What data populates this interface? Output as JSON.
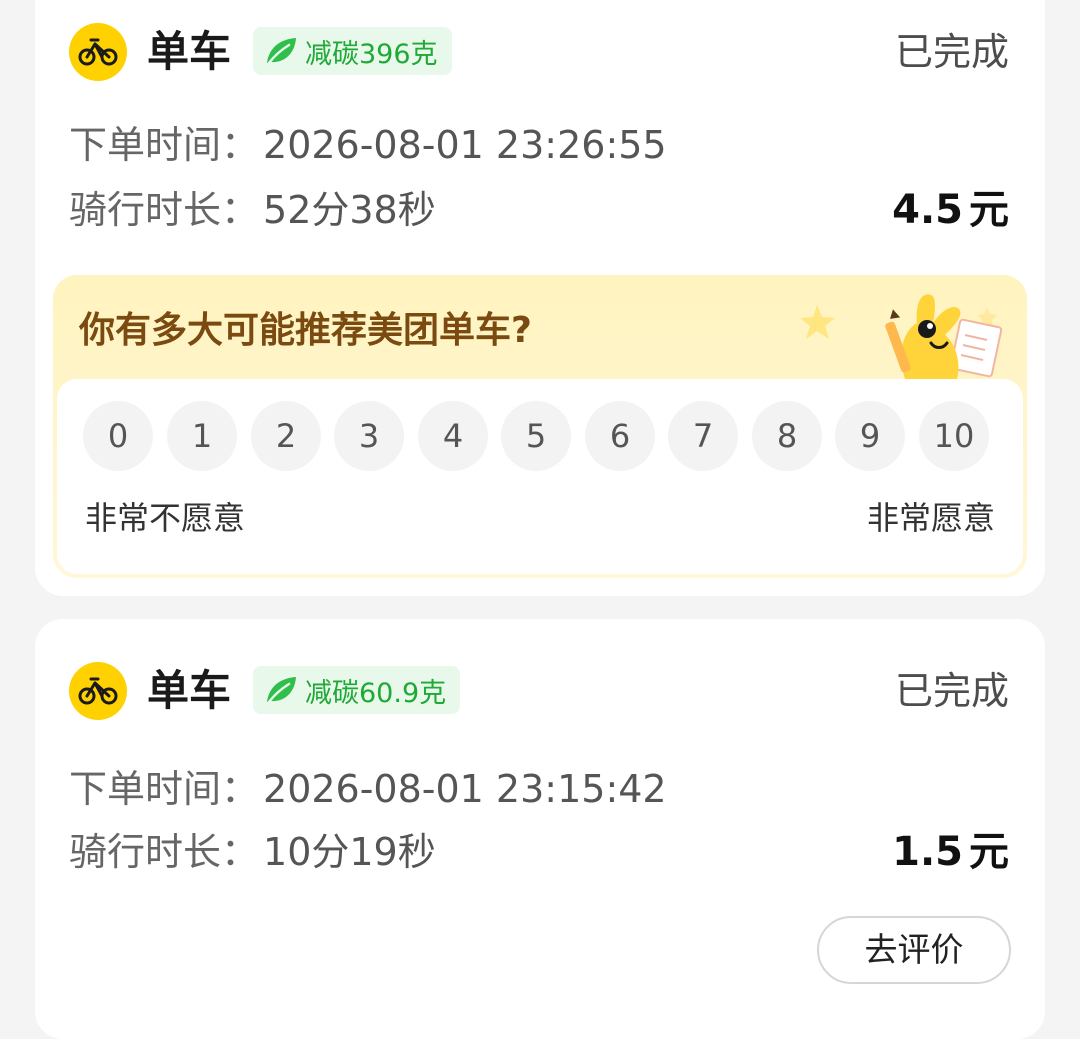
{
  "orders": [
    {
      "type_label": "单车",
      "carbon": "减碳396克",
      "status": "已完成",
      "order_time_label": "下单时间：",
      "order_time": "2026-08-01 23:26:55",
      "duration_label": "骑行时长：",
      "duration": "52分38秒",
      "price": "4.5",
      "price_unit": "元"
    },
    {
      "type_label": "单车",
      "carbon": "减碳60.9克",
      "status": "已完成",
      "order_time_label": "下单时间：",
      "order_time": "2026-08-01 23:15:42",
      "duration_label": "骑行时长：",
      "duration": "10分19秒",
      "price": "1.5",
      "price_unit": "元",
      "review_button": "去评价"
    }
  ],
  "survey": {
    "question": "你有多大可能推荐美团单车?",
    "scores": [
      "0",
      "1",
      "2",
      "3",
      "4",
      "5",
      "6",
      "7",
      "8",
      "9",
      "10"
    ],
    "low_label": "非常不愿意",
    "high_label": "非常愿意"
  },
  "colors": {
    "brand_yellow": "#ffd100",
    "carbon_green": "#1fa936",
    "survey_title": "#7a4a10"
  },
  "icons": {
    "bike_logo": "bike-icon",
    "leaf": "leaf-icon",
    "mascot": "mascot-illustration"
  }
}
